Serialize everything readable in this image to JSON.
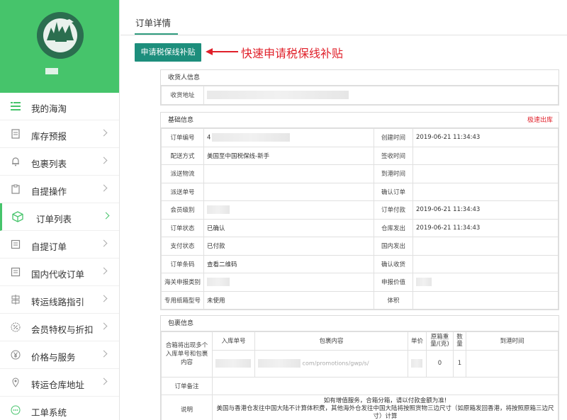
{
  "sidebar": {
    "items": [
      {
        "label": "我的海淘",
        "icon": "menu-lines-icon"
      },
      {
        "label": "库存预报",
        "icon": "document-icon"
      },
      {
        "label": "包裹列表",
        "icon": "bell-icon"
      },
      {
        "label": "自提操作",
        "icon": "clipboard-icon"
      },
      {
        "label": "订单列表",
        "icon": "package-box-icon"
      },
      {
        "label": "自提订单",
        "icon": "receipt-icon"
      },
      {
        "label": "国内代收订单",
        "icon": "receipt-icon"
      },
      {
        "label": "转运线路指引",
        "icon": "signpost-icon"
      },
      {
        "label": "会员特权与折扣",
        "icon": "discount-icon"
      },
      {
        "label": "价格与服务",
        "icon": "yen-icon"
      },
      {
        "label": "转运仓库地址",
        "icon": "location-pin-icon"
      },
      {
        "label": "工单系统",
        "icon": "chat-bubble-icon"
      }
    ],
    "brand_color": "#46c46b"
  },
  "tabs": [
    {
      "label": "订单详情"
    }
  ],
  "actions": {
    "apply_button": "申请税保线补贴"
  },
  "annotation": "快速申请税保线补贴",
  "receiver": {
    "title": "收货人信息",
    "address_label": "收货地址"
  },
  "basic": {
    "title": "基础信息",
    "right_link": "极速出库",
    "rows": [
      {
        "k1": "订单编号",
        "v1": "4",
        "k2": "创建时间",
        "v2": "2019-06-21 11:34:43"
      },
      {
        "k1": "配送方式",
        "v1": "美国至中国税保线-新手",
        "k2": "签收时间",
        "v2": ""
      },
      {
        "k1": "派送物流",
        "v1": "",
        "k2": "到港时间",
        "v2": ""
      },
      {
        "k1": "派送单号",
        "v1": "",
        "k2": "确认订单",
        "v2": ""
      },
      {
        "k1": "会员级别",
        "v1": "",
        "k2": "订单付款",
        "v2": "2019-06-21 11:34:43"
      },
      {
        "k1": "订单状态",
        "v1": "已确认",
        "k2": "仓库发出",
        "v2": "2019-06-21 11:34:43"
      },
      {
        "k1": "支付状态",
        "v1": "已付款",
        "k2": "国内发出",
        "v2": ""
      },
      {
        "k1": "订单条码",
        "v1": "查看二维码",
        "k2": "确认收货",
        "v2": ""
      },
      {
        "k1": "海关申报类别",
        "v1": "",
        "k2": "申报价值",
        "v2": ""
      },
      {
        "k1": "专用纸箱型号",
        "v1": "未使用",
        "k2": "体积",
        "v2": ""
      }
    ]
  },
  "package": {
    "title": "包裹信息",
    "left_note": "合箱将出现多个入库单号和包裹内容",
    "headers": [
      "入库单号",
      "包裹内容",
      "单价",
      "原箱重量/(克)",
      "数量",
      "到港时间"
    ],
    "row": {
      "url_fragment": "com/promotions/gwp/s/",
      "weight": "0",
      "qty": "1"
    },
    "remark_label": "订单备注",
    "desc_label": "说明",
    "desc_line1": "如有增值服务，合箱分箱，请以付款金额为准!",
    "desc_line2": "美国与香港仓发往中国大陆不计算体积费，其他海外仓发往中国大陆将按照货物三边尺寸（如原箱发回香港，将按照原箱三边尺寸）计算"
  },
  "colors": {
    "accent": "#1d8e7c",
    "alert": "#e0202a",
    "tab_underline": "#2f9c7e"
  }
}
